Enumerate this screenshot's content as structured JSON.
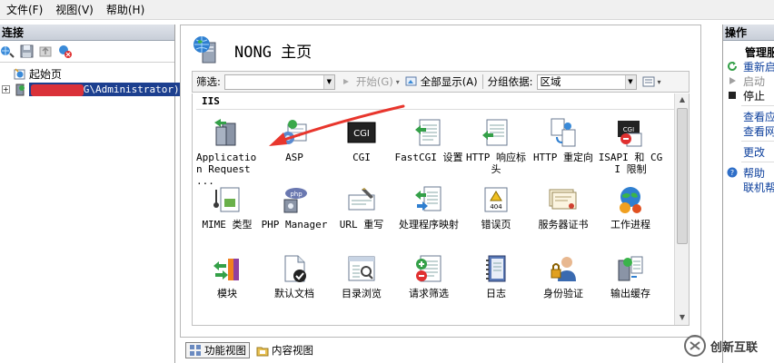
{
  "menu": [
    "文件(F)",
    "视图(V)",
    "帮助(H)"
  ],
  "connections": {
    "header": "连接",
    "tree": [
      {
        "label": "起始页"
      },
      {
        "label": "G\\Administrator)"
      }
    ]
  },
  "main": {
    "title": "NONG 主页",
    "filter": {
      "label": "筛选:",
      "start_label": "开始(G)",
      "show_all_label": "全部显示(A)",
      "group_by_label": "分组依据:",
      "group_by_value": "区域"
    },
    "group_title": "IIS",
    "features": [
      {
        "label": "Application Request ...",
        "icon": "application-request-routing-icon"
      },
      {
        "label": "ASP",
        "icon": "asp-icon"
      },
      {
        "label": "CGI",
        "icon": "cgi-icon"
      },
      {
        "label": "FastCGI 设置",
        "icon": "fastcgi-icon"
      },
      {
        "label": "HTTP 响应标头",
        "icon": "http-response-headers-icon"
      },
      {
        "label": "HTTP 重定向",
        "icon": "http-redirect-icon"
      },
      {
        "label": "ISAPI 和 CGI 限制",
        "icon": "isapi-cgi-restrictions-icon"
      },
      {
        "label": "MIME 类型",
        "icon": "mime-types-icon"
      },
      {
        "label": "PHP Manager",
        "icon": "php-manager-icon"
      },
      {
        "label": "URL 重写",
        "icon": "url-rewrite-icon"
      },
      {
        "label": "处理程序映射",
        "icon": "handler-mappings-icon"
      },
      {
        "label": "错误页",
        "icon": "error-pages-icon"
      },
      {
        "label": "服务器证书",
        "icon": "server-certificates-icon"
      },
      {
        "label": "工作进程",
        "icon": "worker-processes-icon"
      },
      {
        "label": "模块",
        "icon": "modules-icon"
      },
      {
        "label": "默认文档",
        "icon": "default-document-icon"
      },
      {
        "label": "目录浏览",
        "icon": "directory-browsing-icon"
      },
      {
        "label": "请求筛选",
        "icon": "request-filtering-icon"
      },
      {
        "label": "日志",
        "icon": "logging-icon"
      },
      {
        "label": "身份验证",
        "icon": "authentication-icon"
      },
      {
        "label": "输出缓存",
        "icon": "output-caching-icon"
      }
    ],
    "view_tabs": {
      "features": "功能视图",
      "content": "内容视图"
    }
  },
  "actions": {
    "header": "操作",
    "manage_group": "管理服",
    "items": {
      "restart": "重新启",
      "start": "启动",
      "stop": "停止",
      "view1": "查看应",
      "view2": "查看网",
      "change": "更改",
      "help": "帮助",
      "online_help": "联机帮"
    }
  },
  "watermark": "创新互联",
  "colors": {
    "selection": "#1c3f8f",
    "link": "#0c3f9c",
    "arrow": "#e8362d"
  }
}
